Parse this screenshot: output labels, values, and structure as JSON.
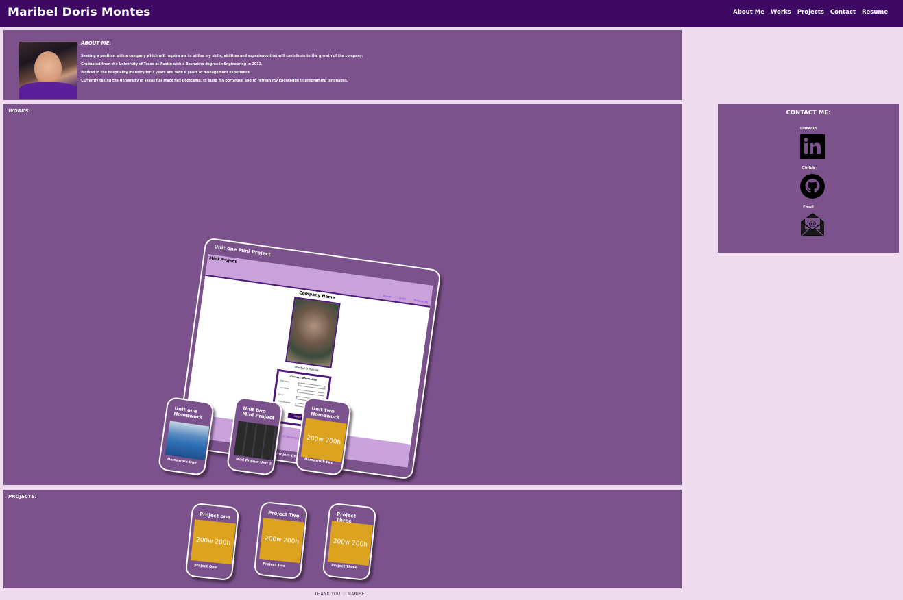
{
  "header": {
    "site_title": "Maribel Doris Montes",
    "nav": [
      "About Me",
      "Works",
      "Projects",
      "Contact",
      "Resume"
    ]
  },
  "about": {
    "title": "ABOUT ME:",
    "lines": [
      "Seeking a position with a company which will require me to utilize my skills, abilities and experience that will contribute to the growth of the company.",
      "Graduated from the University of Texas at Austin with a Bachelors degree in Engineering in 2012.",
      "Worked in the hospitality industry for 7 years and with 6 years of management experience.",
      "Currently taking the University of Texas full stack flex bootcamp, to build my portofolio and to refresh my knowledge in programing languages."
    ]
  },
  "works": {
    "title": "WORKS:",
    "featured": {
      "title": "Unit one Mini Project",
      "caption": "Mini Project Unit 1",
      "screenshot": {
        "header": "Mini Project",
        "nav": [
          "About",
          "Links",
          "Resources"
        ],
        "company": "Company Name",
        "name": "Maribel D Montes",
        "form_title": "Contact Information",
        "fields": [
          "First Name",
          "Last Name",
          "Email",
          "Phone Number"
        ],
        "button": "Submit",
        "footer": "© Company name 2021"
      }
    },
    "cards": [
      {
        "title": "Unit one Homework",
        "caption": "Homework One"
      },
      {
        "title": "Unit two Mini Project",
        "caption": "Mini Project Unit 2"
      },
      {
        "title": "Unit two Homework",
        "caption": "Homework two",
        "placeholder": "200w 200h"
      }
    ]
  },
  "projects": {
    "title": "PROJECTS:",
    "cards": [
      {
        "title": "Project one",
        "caption": "project One",
        "placeholder": "200w 200h"
      },
      {
        "title": "Project Two",
        "caption": "Project Two",
        "placeholder": "200w 200h"
      },
      {
        "title": "Project Three",
        "caption": "Project Three",
        "placeholder": "200w 200h"
      }
    ]
  },
  "contact": {
    "title": "CONTACT ME:",
    "items": [
      {
        "label": "LinkedIn",
        "icon": "linkedin-icon"
      },
      {
        "label": "GitHub",
        "icon": "github-icon"
      },
      {
        "label": "Email",
        "icon": "email-icon"
      }
    ]
  },
  "footer": {
    "text": "THANK YOU ♡ MARIBEL"
  },
  "colors": {
    "header": "#3e0962",
    "panel": "#7b528c",
    "background": "#efdcef",
    "placeholder": "#dba320"
  }
}
